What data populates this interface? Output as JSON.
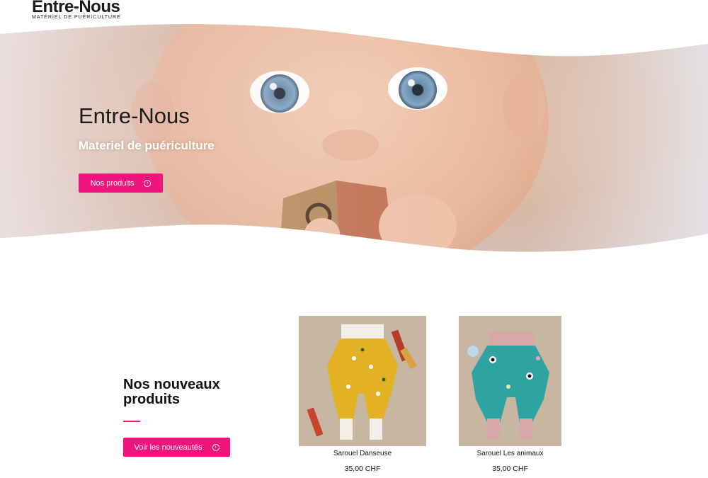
{
  "header": {
    "logo_title": "Entre-Nous",
    "logo_subtitle": "MATÉRIEL DE PUÉRICULTURE"
  },
  "hero": {
    "title": "Entre-Nous",
    "subtitle": "Materiel de puériculture",
    "button_label": "Nos produits",
    "button_icon": "circle-arrow-right-icon"
  },
  "new_products": {
    "heading": "Nos nouveaux produits",
    "button_label": "Voir les nouveautés",
    "button_icon": "circle-arrow-right-icon"
  },
  "products": [
    {
      "name": "Sarouel Danseuse",
      "price": "35,00 CHF"
    },
    {
      "name": "Sarouel Les animaux",
      "price": "35,00 CHF"
    }
  ],
  "colors": {
    "accent": "#f0157d",
    "text": "#111111",
    "background": "#ffffff"
  }
}
